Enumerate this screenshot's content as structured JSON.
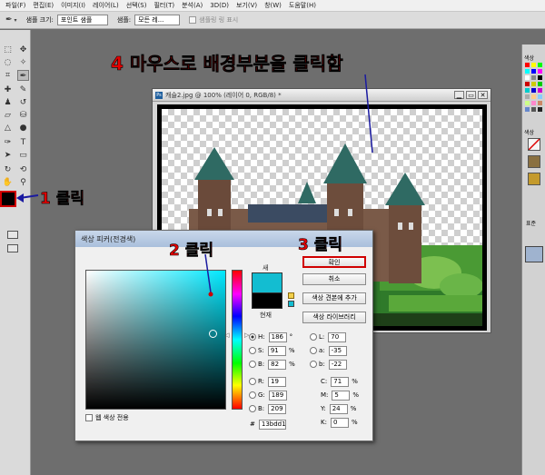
{
  "menubar": [
    "파일(F)",
    "편집(E)",
    "이미지(I)",
    "레이어(L)",
    "선택(S)",
    "필터(T)",
    "분석(A)",
    "3D(D)",
    "보기(V)",
    "창(W)",
    "도움말(H)"
  ],
  "options": {
    "sample_size_label": "샘플 크기:",
    "sample_size_value": "포인트 샘플",
    "sample_label": "샘플:",
    "sample_value": "모든 레...",
    "sample_ring_label": "샘플링 링 표시"
  },
  "document": {
    "title": "캐슬2.jpg @ 100% (레이어 0, RGB/8) *",
    "btn_min": "▁",
    "btn_max": "▭",
    "btn_close": "✕"
  },
  "picker": {
    "title": "색상 피커(전경색)",
    "new_label": "새",
    "current_label": "현재",
    "ok": "확인",
    "cancel": "취소",
    "add_swatches": "색상 견본에 추가",
    "color_libraries": "색상 라이브러리",
    "hsb": [
      {
        "label": "H:",
        "value": "186",
        "unit": "°"
      },
      {
        "label": "S:",
        "value": "91",
        "unit": "%"
      },
      {
        "label": "B:",
        "value": "82",
        "unit": "%"
      }
    ],
    "rgb": [
      {
        "label": "R:",
        "value": "19"
      },
      {
        "label": "G:",
        "value": "189"
      },
      {
        "label": "B:",
        "value": "209"
      }
    ],
    "lab": [
      {
        "label": "L:",
        "value": "70"
      },
      {
        "label": "a:",
        "value": "-35"
      },
      {
        "label": "b:",
        "value": "-22"
      }
    ],
    "cmyk": [
      {
        "label": "C:",
        "value": "71",
        "unit": "%"
      },
      {
        "label": "M:",
        "value": "5",
        "unit": "%"
      },
      {
        "label": "Y:",
        "value": "24",
        "unit": "%"
      },
      {
        "label": "K:",
        "value": "0",
        "unit": "%"
      }
    ],
    "hex_label": "#",
    "hex_value": "13bdd1",
    "web_only": "웹 색상 전용",
    "new_color": "#13bdd1",
    "current_color": "#000000"
  },
  "panels": {
    "color_tab": "색상",
    "swatch_tab": "색상",
    "layers_tab": "표준"
  },
  "annotations": {
    "step1": "1 클릭",
    "step2": "2 클릭",
    "step3": "3 클릭",
    "step4": "4 마우스로 배경부분을 클릭함"
  },
  "colors": {
    "annotation_red": "#e50000",
    "picked_cyan": "#13bdd1"
  }
}
